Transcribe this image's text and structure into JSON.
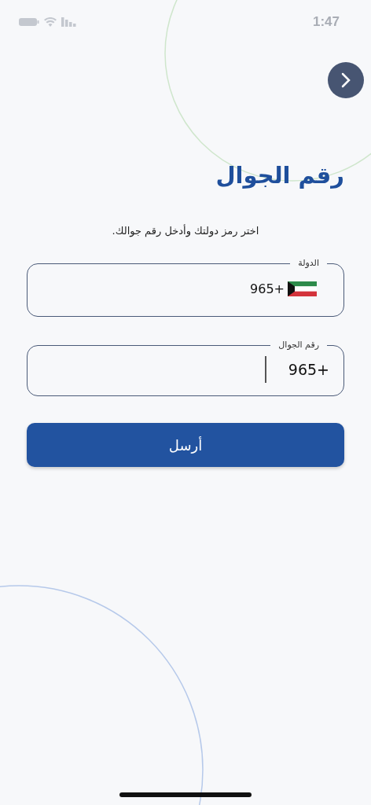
{
  "status_bar": {
    "time": "1:47"
  },
  "title": "رقم الجوال",
  "instruction": "اختر رمز دولتك وأدخل رقم جوالك.",
  "country_field": {
    "label": "الدولة",
    "value": "965+"
  },
  "phone_field": {
    "label": "رقم الجوال",
    "prefix": "965+"
  },
  "submit_button": "أرسل"
}
